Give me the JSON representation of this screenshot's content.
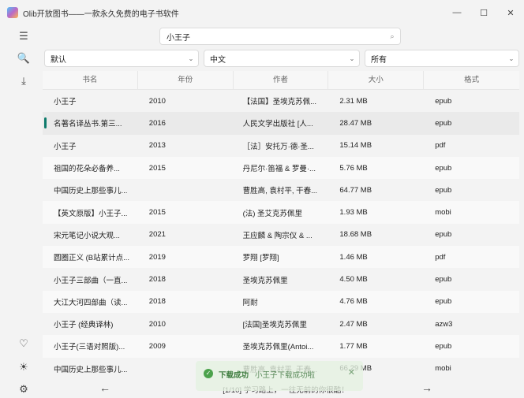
{
  "window": {
    "title": "Olib开放图书——一款永久免费的电子书软件",
    "min": "—",
    "max": "☐",
    "close": "✕"
  },
  "sidebar": {
    "menu": "☰",
    "search": "🔍",
    "download": "⤓",
    "favorite": "♡",
    "theme": "☀",
    "settings": "⚙"
  },
  "search": {
    "value": "小王子",
    "icon": "⌕"
  },
  "filters": [
    {
      "value": "默认",
      "chev": "⌄"
    },
    {
      "value": "中文",
      "chev": "⌄"
    },
    {
      "value": "所有",
      "chev": "⌄"
    }
  ],
  "table": {
    "headers": [
      "书名",
      "年份",
      "作者",
      "大小",
      "格式"
    ],
    "rows": [
      [
        "小王子",
        "2010",
        "【法国】圣埃克苏佩...",
        "2.31 MB",
        "epub"
      ],
      [
        "名著名译丛书.第三...",
        "2016",
        "人民文学出版社 [人...",
        "28.47 MB",
        "epub"
      ],
      [
        "小王子",
        "2013",
        "［法］安托万·德·圣...",
        "15.14 MB",
        "pdf"
      ],
      [
        "祖国的花朵必备养...",
        "2015",
        "丹尼尔·笛福 & 罗曼·...",
        "5.76 MB",
        "epub"
      ],
      [
        "中国历史上那些事儿...",
        "",
        "曹胜高, 袁村平, 干春...",
        "64.77 MB",
        "epub"
      ],
      [
        "【英文原版】小王子...",
        "2015",
        "(法) 圣艾克苏佩里",
        "1.93 MB",
        "mobi"
      ],
      [
        "宋元笔记小说大观...",
        "2021",
        "王应麟 & 陶宗仪 & ...",
        "18.68 MB",
        "epub"
      ],
      [
        "圆圈正义 (B站累计点...",
        "2019",
        "罗翔 [罗翔]",
        "1.46 MB",
        "pdf"
      ],
      [
        "小王子三部曲（一直...",
        "2018",
        "圣埃克苏佩里",
        "4.50 MB",
        "epub"
      ],
      [
        "大江大河四部曲（读...",
        "2018",
        "阿耐",
        "4.76 MB",
        "epub"
      ],
      [
        "小王子 (经典译林)",
        "2010",
        "[法国]圣埃克苏佩里",
        "2.47 MB",
        "azw3"
      ],
      [
        "小王子(三语对照版)...",
        "2009",
        "圣埃克苏佩里(Antoi...",
        "1.77 MB",
        "epub"
      ],
      [
        "中国历史上那些事儿...",
        "",
        "曹胜高, 袁村平, 干春...",
        "66.29 MB",
        "mobi"
      ]
    ]
  },
  "footer": {
    "prev": "←",
    "next": "→",
    "status": "[1/10] 学习路上，一往无前的你很酷！"
  },
  "toast": {
    "icon": "✓",
    "title": "下载成功",
    "message": "小王子下载成功啦",
    "close": "✕"
  }
}
